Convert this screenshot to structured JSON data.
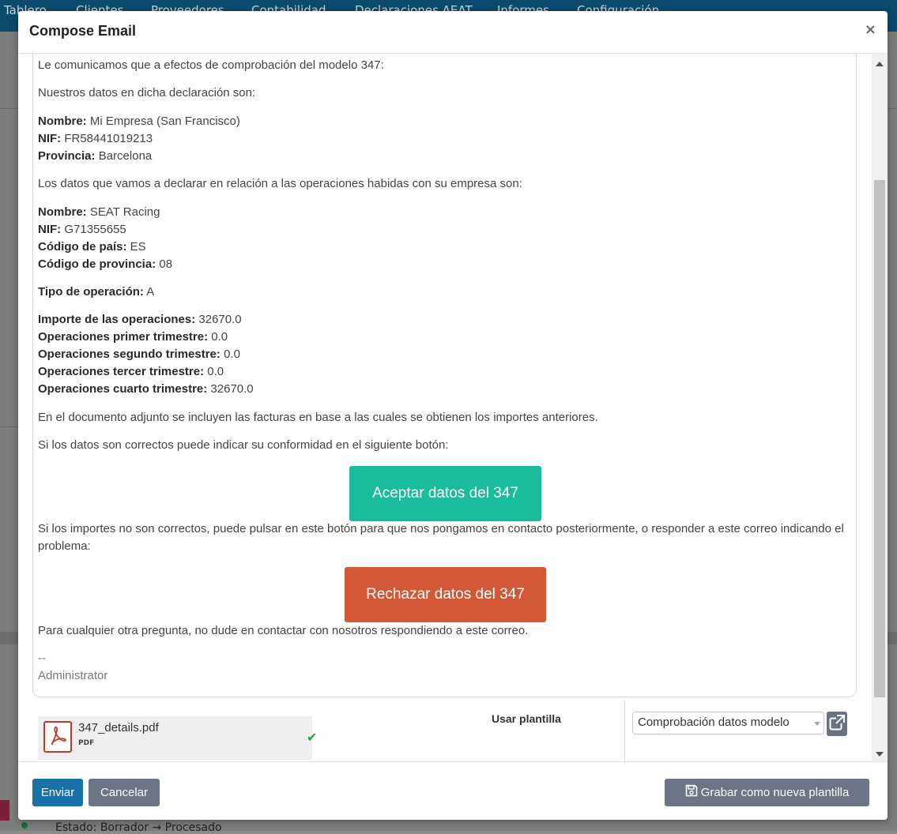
{
  "background": {
    "nav_items": [
      "Tablero",
      "Clientes",
      "Proveedores",
      "Contabilidad",
      "Declaraciones AEAT",
      "Informes",
      "Configuración"
    ],
    "bottom_status": "Estado: Borrador → Procesado"
  },
  "modal": {
    "title": "Compose Email",
    "close_label": "×"
  },
  "email": {
    "intro": "Le comunicamos que a efectos de comprobación del modelo 347:",
    "our_data_heading": "Nuestros datos en dicha declaración son:",
    "our_data": [
      {
        "label": "Nombre:",
        "value": "Mi Empresa (San Francisco)"
      },
      {
        "label": "NIF:",
        "value": "FR58441019213"
      },
      {
        "label": "Provincia:",
        "value": "Barcelona"
      }
    ],
    "declare_heading": "Los datos que vamos a declarar en relación a las operaciones habidas con su empresa son:",
    "partner_data": [
      {
        "label": "Nombre:",
        "value": "SEAT Racing"
      },
      {
        "label": "NIF:",
        "value": "G71355655"
      },
      {
        "label": "Código de país:",
        "value": "ES"
      },
      {
        "label": "Código de provincia:",
        "value": "08"
      }
    ],
    "operation_type": {
      "label": "Tipo de operación:",
      "value": "A"
    },
    "amounts": [
      {
        "label": "Importe de las operaciones:",
        "value": "32670.0"
      },
      {
        "label": "Operaciones primer trimestre:",
        "value": "0.0"
      },
      {
        "label": "Operaciones segundo trimestre:",
        "value": "0.0"
      },
      {
        "label": "Operaciones tercer trimestre:",
        "value": "0.0"
      },
      {
        "label": "Operaciones cuarto trimestre:",
        "value": "32670.0"
      }
    ],
    "attachment_note": "En el documento adjunto se incluyen las facturas en base a las cuales se obtienen los importes anteriores.",
    "confirm_note": "Si los datos son correctos puede indicar su conformidad en el siguiente botón:",
    "accept_button": "Aceptar datos del 347",
    "reject_note": "Si los importes no son correctos, puede pulsar en este botón para que nos pongamos en contacto posteriormente, o responder a este correo indicando el problema:",
    "reject_button": "Rechazar datos del 347",
    "closing": "Para cualquier otra pregunta, no dude en contactar con nosotros respondiendo a este correo.",
    "signature_dash": "--",
    "signature_name": "Administrator"
  },
  "attachment": {
    "file_name": "347_details.pdf",
    "file_type": "PDF",
    "icon": "pdf-file-icon",
    "status_icon": "check-icon"
  },
  "template": {
    "label": "Usar plantilla",
    "selected": "Comprobación datos modelo"
  },
  "footer": {
    "send": "Enviar",
    "cancel": "Cancelar",
    "save_template": "Grabar como nueva plantilla"
  },
  "colors": {
    "accept": "#1abc9c",
    "reject": "#d35837",
    "primary": "#1871a8",
    "secondary": "#6c7485"
  }
}
